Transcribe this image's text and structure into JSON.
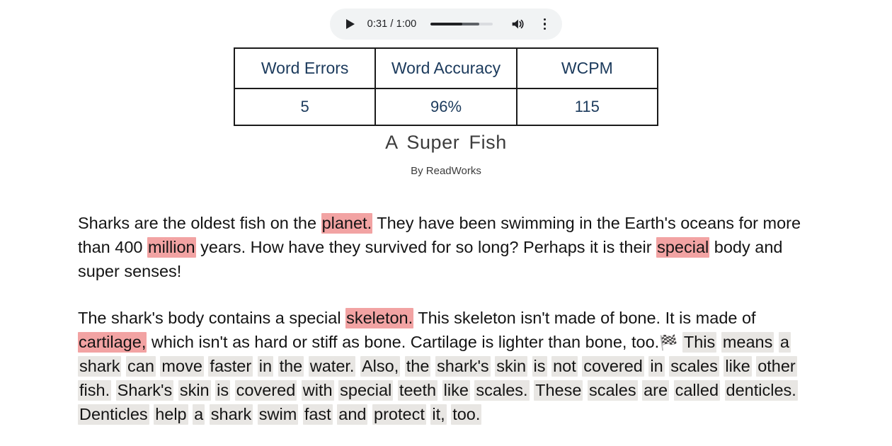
{
  "player": {
    "play_icon": "play-icon",
    "time_display": "0:31 / 1:00",
    "current_time": "0:31",
    "total_time": "1:00",
    "progress_played_percent": 51,
    "progress_buffered_percent": 78,
    "volume_icon": "volume-icon",
    "menu_icon": "more-options-icon"
  },
  "metrics": {
    "headers": [
      "Word Errors",
      "Word Accuracy",
      "WCPM"
    ],
    "values": [
      "5",
      "96%",
      "115"
    ],
    "text_color": "#1b3a5c"
  },
  "document": {
    "title": "A Super Fish",
    "byline": "By ReadWorks"
  },
  "colors": {
    "error_highlight": "#f2a3a3",
    "read_highlight": "#e8e6e3",
    "table_text": "#1b3a5c",
    "player_bg": "#f1f3f4"
  },
  "passage": {
    "paragraphs": [
      {
        "id": "paragraph-1",
        "tokens": [
          {
            "t": "Sharks are the oldest fish on the ",
            "h": "none"
          },
          {
            "t": "planet.",
            "h": "error"
          },
          {
            "t": " They have been swimming  in the Earth's oceans for more than 400 ",
            "h": "none"
          },
          {
            "t": "million",
            "h": "error"
          },
          {
            "t": " years. How have  they survived for so long? Perhaps it is their ",
            "h": "none"
          },
          {
            "t": "special",
            "h": "error"
          },
          {
            "t": " body and super  senses!",
            "h": "none"
          }
        ]
      },
      {
        "id": "paragraph-2",
        "tokens": [
          {
            "t": "The shark's body contains a special ",
            "h": "none"
          },
          {
            "t": "skeleton.",
            "h": "error"
          },
          {
            "t": " This skeleton isn't  made of bone. It is made of ",
            "h": "none"
          },
          {
            "t": "cartilage,",
            "h": "error"
          },
          {
            "t": " which isn't as hard or stiff as  bone. Cartilage is lighter than bone, too.",
            "h": "none"
          },
          {
            "t": "🏁",
            "h": "flag"
          },
          {
            "t": "This",
            "h": "read"
          },
          {
            "t": "means",
            "h": "read"
          },
          {
            "t": "a",
            "h": "read"
          },
          {
            "t": "shark",
            "h": "read"
          },
          {
            "t": "can",
            "h": "read"
          },
          {
            "t": "move",
            "h": "read"
          },
          {
            "t": "faster",
            "h": "read"
          },
          {
            "t": "in",
            "h": "read"
          },
          {
            "t": "the",
            "h": "read"
          },
          {
            "t": "water.",
            "h": "read"
          },
          {
            "t": "Also,",
            "h": "read"
          },
          {
            "t": "the",
            "h": "read"
          },
          {
            "t": "shark's",
            "h": "read"
          },
          {
            "t": "skin",
            "h": "read"
          },
          {
            "t": "is",
            "h": "read"
          },
          {
            "t": "not",
            "h": "read"
          },
          {
            "t": "covered",
            "h": "read"
          },
          {
            "t": "in",
            "h": "read"
          },
          {
            "t": "scales",
            "h": "read"
          },
          {
            "t": "like",
            "h": "read"
          },
          {
            "t": "other",
            "h": "read"
          },
          {
            "t": "fish.",
            "h": "read"
          },
          {
            "t": "Shark's",
            "h": "read"
          },
          {
            "t": "skin",
            "h": "read"
          },
          {
            "t": "is",
            "h": "read"
          },
          {
            "t": "covered",
            "h": "read"
          },
          {
            "t": "with",
            "h": "read"
          },
          {
            "t": "special",
            "h": "read"
          },
          {
            "t": "teeth",
            "h": "read"
          },
          {
            "t": "like",
            "h": "read"
          },
          {
            "t": "scales.",
            "h": "read"
          },
          {
            "t": "These",
            "h": "read"
          },
          {
            "t": "scales",
            "h": "read"
          },
          {
            "t": "are",
            "h": "read"
          },
          {
            "t": "called",
            "h": "read"
          },
          {
            "t": "denticles.",
            "h": "read"
          },
          {
            "t": "Denticles",
            "h": "read"
          },
          {
            "t": "help",
            "h": "read"
          },
          {
            "t": "a",
            "h": "read"
          },
          {
            "t": "shark",
            "h": "read"
          },
          {
            "t": "swim",
            "h": "read"
          },
          {
            "t": "fast",
            "h": "read"
          },
          {
            "t": "and",
            "h": "read"
          },
          {
            "t": "protect",
            "h": "read"
          },
          {
            "t": "it,",
            "h": "read"
          },
          {
            "t": "too.",
            "h": "read"
          }
        ]
      }
    ]
  }
}
